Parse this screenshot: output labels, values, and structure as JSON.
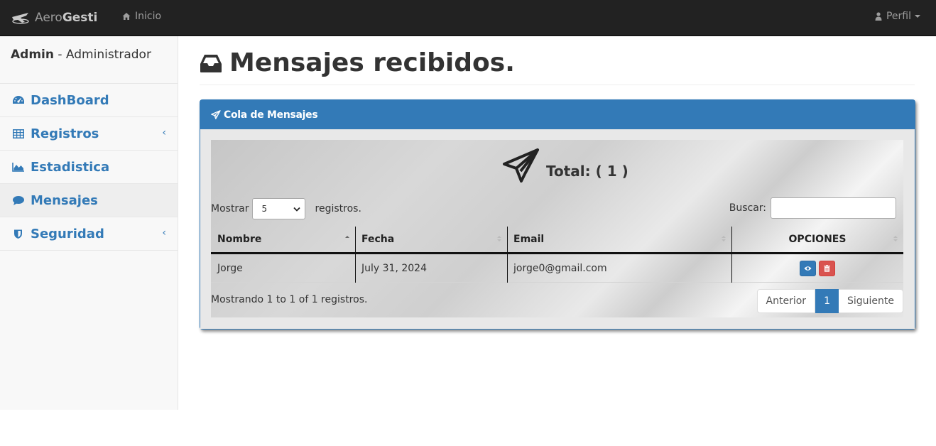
{
  "navbar": {
    "brand_prefix": "Aero",
    "brand_bold": "Gesti",
    "home_label": "Inicio",
    "profile_label": "Perfil"
  },
  "sidebar": {
    "user_name": "Admin",
    "user_role": " - Administrador",
    "items": [
      {
        "label": "DashBoard",
        "icon": "dashboard-icon"
      },
      {
        "label": "Registros",
        "icon": "table-icon",
        "has_submenu": true
      },
      {
        "label": "Estadistica",
        "icon": "area-chart-icon"
      },
      {
        "label": "Mensajes",
        "icon": "comment-icon",
        "active": true
      },
      {
        "label": "Seguridad",
        "icon": "shield-icon",
        "has_submenu": true
      }
    ]
  },
  "page": {
    "title": "Mensajes recibidos."
  },
  "panel": {
    "heading": "Cola de Mensajes",
    "total_label": "Total: ( 1 )",
    "show_prefix": "Mostrar",
    "page_length": "5",
    "show_suffix": "registros.",
    "search_label": "Buscar:",
    "search_value": "",
    "columns": [
      "Nombre",
      "Fecha",
      "Email",
      "OPCIONES"
    ],
    "rows": [
      {
        "nombre": "Jorge",
        "fecha": "July 31, 2024",
        "email": "jorge0@gmail.com"
      }
    ],
    "info": "Mostrando 1 to 1 of 1 registros.",
    "pager": {
      "prev": "Anterior",
      "current": "1",
      "next": "Siguiente"
    }
  },
  "colors": {
    "navbar_bg": "#222222",
    "primary": "#337ab7",
    "danger": "#d9534f",
    "sidebar_bg": "#f8f8f8"
  }
}
